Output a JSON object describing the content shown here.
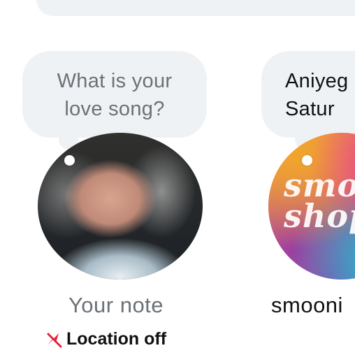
{
  "notes": [
    {
      "bubble_text": "What is your\nlove song?",
      "name": "Your note",
      "location_text": "Location off"
    },
    {
      "bubble_text": "Aniyeg\nSatur",
      "name": "smooni",
      "avatar_text_line1": "smo",
      "avatar_text_line2": "shop"
    }
  ],
  "icons": {
    "location": "location-off-icon"
  },
  "colors": {
    "bubble_bg": "#eff2f5",
    "muted_text": "#6b7178",
    "location_icon": "#e8213b"
  }
}
